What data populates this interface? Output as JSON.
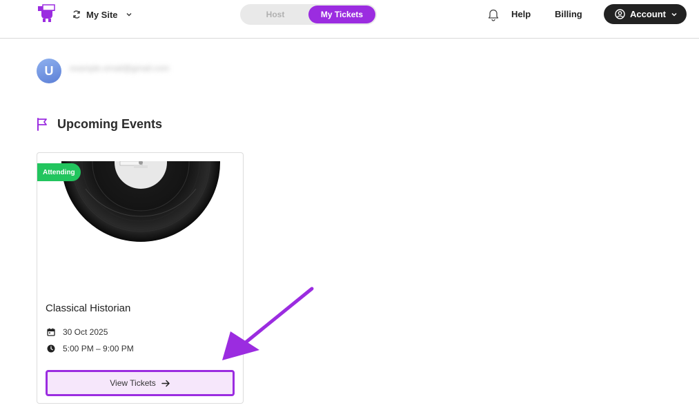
{
  "header": {
    "site_name": "My Site",
    "toggle": {
      "host": "Host",
      "tickets": "My Tickets",
      "active": "My Tickets"
    },
    "help": "Help",
    "billing": "Billing",
    "account": "Account",
    "accent_color": "#9b2ce0"
  },
  "user": {
    "avatar_initial": "U",
    "email": "example.email@gmail.com"
  },
  "section": {
    "title": "Upcoming Events",
    "icon": "flag-icon"
  },
  "event": {
    "badge": "Attending",
    "badge_color": "#22c55e",
    "title": "Classical Historian",
    "date": "30 Oct 2025",
    "time": "5:00 PM – 9:00 PM",
    "button": "View Tickets"
  }
}
